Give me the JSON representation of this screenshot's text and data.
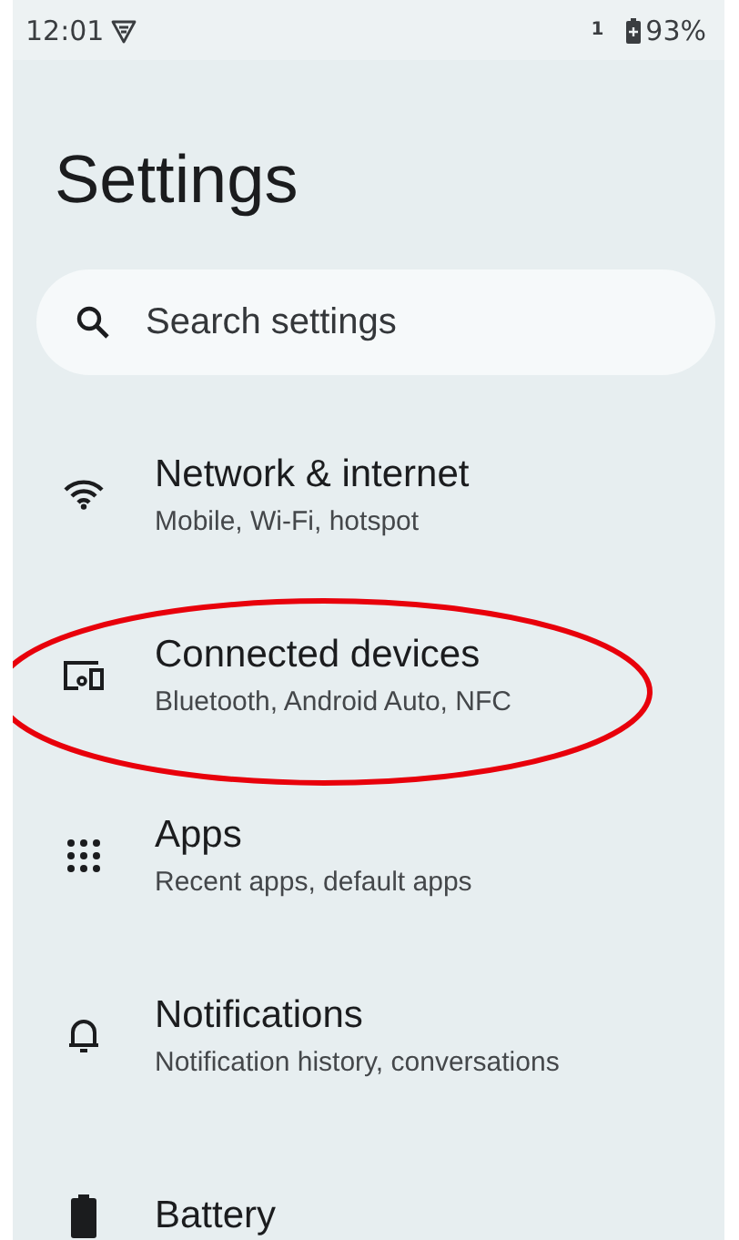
{
  "status_bar": {
    "time": "12:01",
    "sim_label": "1",
    "battery": "93%"
  },
  "title": "Settings",
  "search": {
    "placeholder": "Search settings"
  },
  "items": [
    {
      "kind": "wifi",
      "title": "Network & internet",
      "subtitle": "Mobile, Wi-Fi, hotspot",
      "circled": false
    },
    {
      "kind": "devices",
      "title": "Connected devices",
      "subtitle": "Bluetooth, Android Auto, NFC",
      "circled": true
    },
    {
      "kind": "apps",
      "title": "Apps",
      "subtitle": "Recent apps, default apps",
      "circled": false
    },
    {
      "kind": "bell",
      "title": "Notifications",
      "subtitle": "Notification history, conversations",
      "circled": false
    },
    {
      "kind": "battery",
      "title": "Battery",
      "circled": false
    }
  ]
}
